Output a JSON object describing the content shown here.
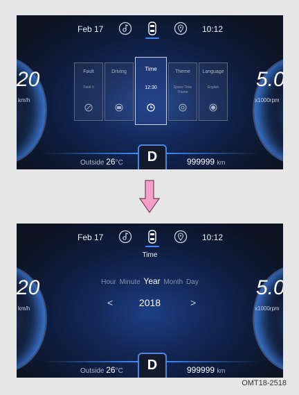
{
  "screens": [
    {
      "date": "Feb 17",
      "clock": "10:12",
      "speed": "20",
      "speed_unit": "km/h",
      "rpm": "5.0",
      "rpm_unit": "x1000rpm",
      "outside_label": "Outside",
      "outside_temp": "26",
      "temp_unit": "°C",
      "gear": "D",
      "odometer": "999999",
      "odo_unit": "km",
      "menu": {
        "items": [
          {
            "title": "Fault",
            "sub": "Fault 0",
            "icon": "fault-icon"
          },
          {
            "title": "Driving",
            "sub": "",
            "icon": "driving-icon"
          },
          {
            "title": "Time",
            "sub": "12:30",
            "icon": "clock-icon"
          },
          {
            "title": "Theme",
            "sub": "Space Time Theme",
            "icon": "theme-icon"
          },
          {
            "title": "Language",
            "sub": "English",
            "icon": "language-icon"
          }
        ],
        "selected": "Time"
      }
    },
    {
      "date": "Feb 17",
      "clock": "10:12",
      "speed": "20",
      "speed_unit": "km/h",
      "rpm": "5.0",
      "rpm_unit": "x1000rpm",
      "outside_label": "Outside",
      "outside_temp": "26",
      "temp_unit": "°C",
      "gear": "D",
      "odometer": "999999",
      "odo_unit": "km",
      "time_setting": {
        "title": "Time",
        "fields": [
          "Hour",
          "Minute",
          "Year",
          "Month",
          "Day"
        ],
        "selected_field": "Year",
        "value": "2018",
        "prev": "<",
        "next": ">"
      }
    }
  ],
  "top_icons": [
    "music-icon",
    "car-icon",
    "location-icon"
  ],
  "caption": "OMT18-2518",
  "colors": {
    "accent": "#3e8cff",
    "arrow": "#f2a0c8"
  }
}
